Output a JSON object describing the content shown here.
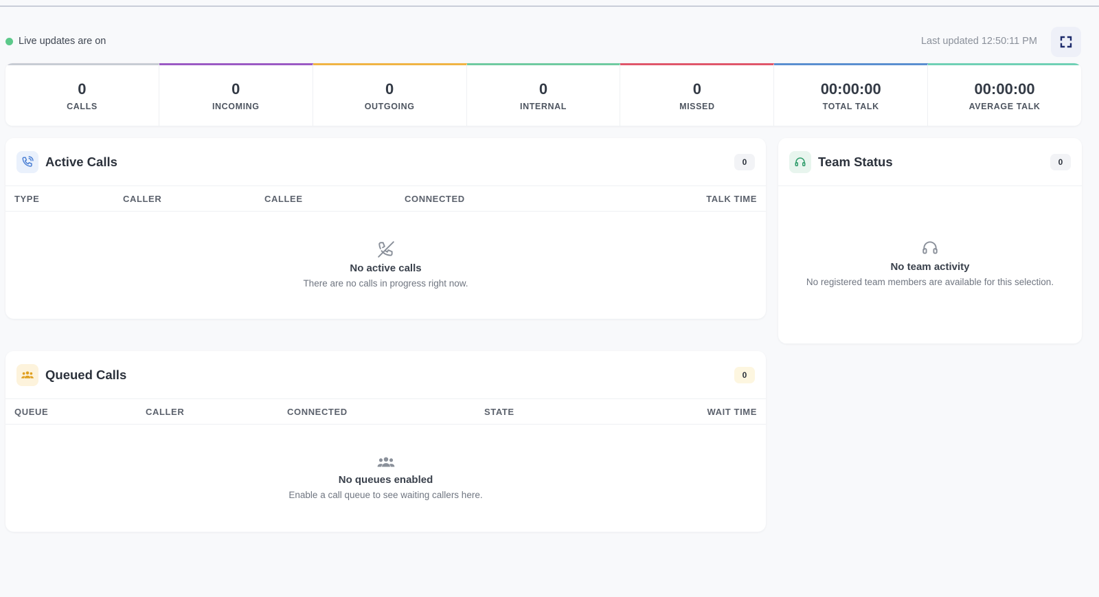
{
  "status": {
    "live_label": "Live updates are on",
    "last_updated": "Last updated 12:50:11 PM",
    "live_color": "#5cc98a"
  },
  "stats": [
    {
      "value": "0",
      "label": "CALLS",
      "color": "#c8ccd4"
    },
    {
      "value": "0",
      "label": "INCOMING",
      "color": "#9b59c4"
    },
    {
      "value": "0",
      "label": "OUTGOING",
      "color": "#f0b444"
    },
    {
      "value": "0",
      "label": "INTERNAL",
      "color": "#6fcaa0"
    },
    {
      "value": "0",
      "label": "MISSED",
      "color": "#e0566a"
    },
    {
      "value": "00:00:00",
      "label": "TOTAL TALK",
      "color": "#5a8fd0"
    },
    {
      "value": "00:00:00",
      "label": "AVERAGE TALK",
      "color": "#6fd0b5"
    }
  ],
  "active_calls": {
    "title": "Active Calls",
    "count": "0",
    "columns": [
      "TYPE",
      "CALLER",
      "CALLEE",
      "CONNECTED",
      "TALK TIME"
    ],
    "empty_title": "No active calls",
    "empty_sub": "There are no calls in progress right now.",
    "icon": "phone-icon",
    "accent": "#4a7fd4"
  },
  "team_status": {
    "title": "Team Status",
    "count": "0",
    "empty_title": "No team activity",
    "empty_sub": "No registered team members are available for this selection.",
    "icon": "headset-icon",
    "accent": "#2e9c6a"
  },
  "queued_calls": {
    "title": "Queued Calls",
    "count": "0",
    "columns": [
      "QUEUE",
      "CALLER",
      "CONNECTED",
      "STATE",
      "WAIT TIME"
    ],
    "empty_title": "No queues enabled",
    "empty_sub": "Enable a call queue to see waiting callers here.",
    "icon": "users-icon",
    "accent": "#e0a020"
  }
}
